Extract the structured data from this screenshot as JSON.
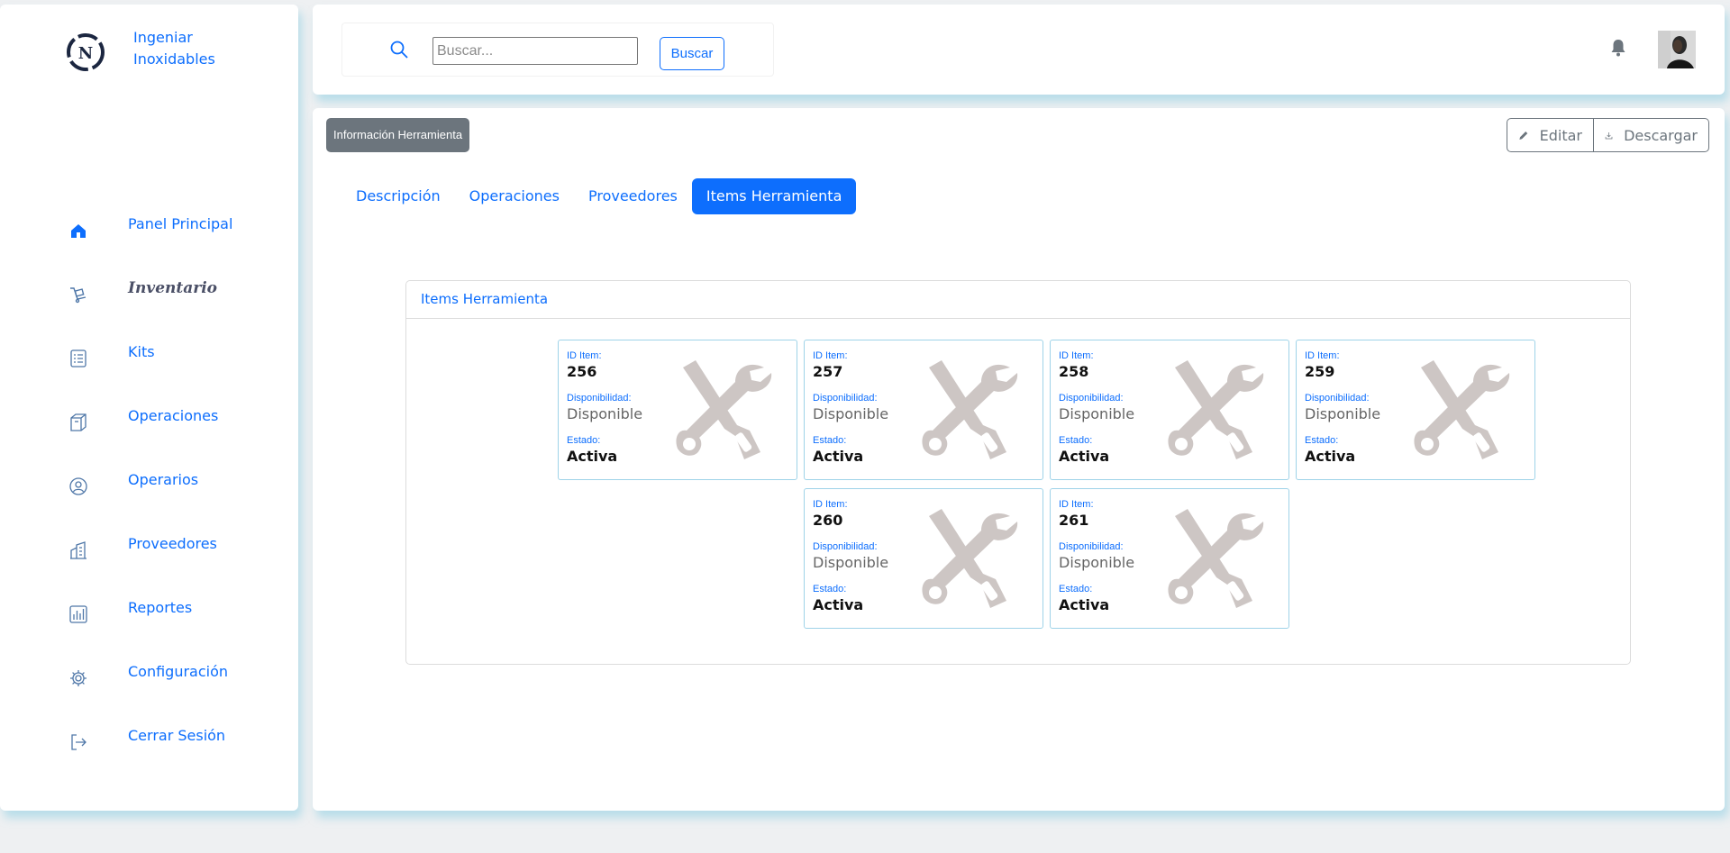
{
  "brand": {
    "name": "Ingeniar Inoxidables"
  },
  "sidebar": {
    "items": [
      {
        "label": "Panel Principal",
        "icon": "home-icon"
      },
      {
        "label": "Inventario",
        "icon": "inventory-icon",
        "active": true
      },
      {
        "label": "Kits",
        "icon": "checklist-icon"
      },
      {
        "label": "Operaciones",
        "icon": "box-icon"
      },
      {
        "label": "Operarios",
        "icon": "user-circle-icon"
      },
      {
        "label": "Proveedores",
        "icon": "building-icon"
      },
      {
        "label": "Reportes",
        "icon": "chart-icon"
      },
      {
        "label": "Configuración",
        "icon": "gear-icon"
      },
      {
        "label": "Cerrar Sesión",
        "icon": "logout-icon"
      }
    ]
  },
  "search": {
    "placeholder": "Buscar...",
    "value": "",
    "button_label": "Buscar"
  },
  "header": {
    "bell_icon": "bell-icon",
    "avatar": "user-avatar"
  },
  "page": {
    "badge": "Información Herramienta",
    "edit_label": "Editar",
    "download_label": "Descargar"
  },
  "tabs": [
    {
      "label": "Descripción"
    },
    {
      "label": "Operaciones"
    },
    {
      "label": "Proveedores"
    },
    {
      "label": "Items Herramienta",
      "active": true
    }
  ],
  "items_card": {
    "title": "Items Herramienta",
    "id_label": "ID Item:",
    "disp_label": "Disponibilidad:",
    "state_label": "Estado:",
    "items": [
      {
        "id": "256",
        "disponibilidad": "Disponible",
        "estado": "Activa"
      },
      {
        "id": "257",
        "disponibilidad": "Disponible",
        "estado": "Activa"
      },
      {
        "id": "258",
        "disponibilidad": "Disponible",
        "estado": "Activa"
      },
      {
        "id": "259",
        "disponibilidad": "Disponible",
        "estado": "Activa"
      },
      {
        "id": "260",
        "disponibilidad": "Disponible",
        "estado": "Activa"
      },
      {
        "id": "261",
        "disponibilidad": "Disponible",
        "estado": "Activa"
      }
    ]
  },
  "colors": {
    "primary": "#0d6efd",
    "secondary": "#6c757d",
    "tool_icon": "#cdc6c4"
  }
}
